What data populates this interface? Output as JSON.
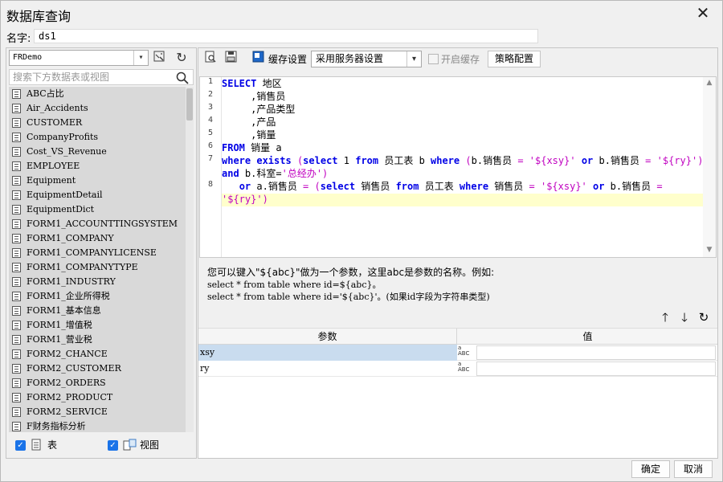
{
  "window": {
    "title": "数据库查询"
  },
  "name": {
    "label": "名字:",
    "value": "ds1"
  },
  "left": {
    "connection": "FRDemo",
    "search_placeholder": "搜索下方数据表或视图",
    "tables": [
      "ABC占比",
      "Air_Accidents",
      "CUSTOMER",
      "CompanyProfits",
      "Cost_VS_Revenue",
      "EMPLOYEE",
      "Equipment",
      "EquipmentDetail",
      "EquipmentDict",
      "FORM1_ACCOUNTTINGSYSTEM",
      "FORM1_COMPANY",
      "FORM1_COMPANYLICENSE",
      "FORM1_COMPANYTYPE",
      "FORM1_INDUSTRY",
      "FORM1_企业所得税",
      "FORM1_基本信息",
      "FORM1_增值税",
      "FORM1_营业税",
      "FORM2_CHANCE",
      "FORM2_CUSTOMER",
      "FORM2_ORDERS",
      "FORM2_PRODUCT",
      "FORM2_SERVICE",
      "F财务指标分析"
    ],
    "checkbox_table_label": "表",
    "checkbox_view_label": "视图"
  },
  "toolbar": {
    "cache_label": "缓存设置",
    "cache_option": "采用服务器设置",
    "enable_cache_label": "开启缓存",
    "strategy_button": "策略配置"
  },
  "editor": {
    "line_numbers": [
      "1",
      "2",
      "3",
      "4",
      "5",
      "6",
      "7",
      "",
      "8",
      ""
    ]
  },
  "hint": {
    "line1": "您可以键入\"${abc}\"做为一个参数，这里abc是参数的名称。例如:",
    "line2": "select * from table where id=${abc}。",
    "line3": "select * from table where id='${abc}'。(如果id字段为字符串类型)"
  },
  "params": {
    "header_name": "参数",
    "header_value": "值",
    "rows": [
      {
        "name": "xsy",
        "type": "ABC",
        "value": ""
      },
      {
        "name": "ry",
        "type": "ABC",
        "value": ""
      }
    ]
  },
  "footer": {
    "ok": "确定",
    "cancel": "取消"
  }
}
